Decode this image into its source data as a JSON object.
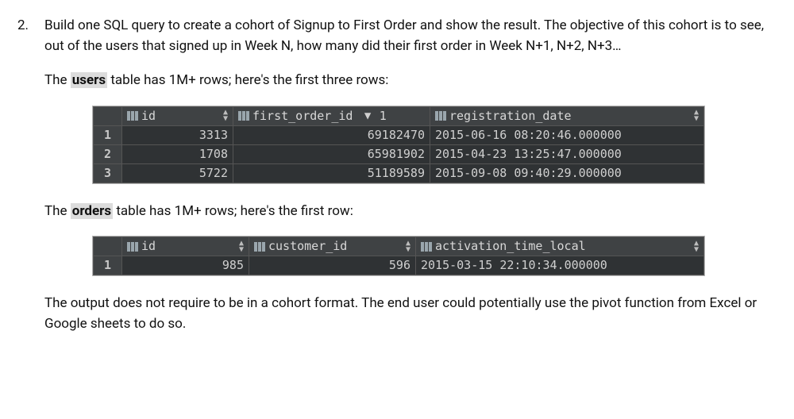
{
  "question": {
    "number": "2.",
    "prompt_main": "Build one SQL query to create a cohort of Signup to First Order and show the result. The objective of this cohort is to see, out of the users that signed up in Week N, how many did their first order in Week N+1, N+2, N+3…",
    "users_intro_pre": "The ",
    "users_intro_hl": "users",
    "users_intro_post": " table has 1M+ rows; here's the first three rows:",
    "orders_intro_pre": "The ",
    "orders_intro_hl": "orders",
    "orders_intro_post": " table has 1M+ rows; here's the first row:",
    "footer": "The output does not require to be in a cohort format. The end user could  potentially use the pivot function from Excel or Google sheets to do so."
  },
  "users_table": {
    "columns": [
      {
        "label": "id",
        "sort": "both"
      },
      {
        "label": "first_order_id",
        "sort": "down",
        "badge": "1"
      },
      {
        "label": "registration_date",
        "sort": "both"
      }
    ],
    "rows": [
      {
        "n": "1",
        "id": "3313",
        "first_order_id": "69182470",
        "registration_date": "2015-06-16 08:20:46.000000"
      },
      {
        "n": "2",
        "id": "1708",
        "first_order_id": "65981902",
        "registration_date": "2015-04-23 13:25:47.000000"
      },
      {
        "n": "3",
        "id": "5722",
        "first_order_id": "51189589",
        "registration_date": "2015-09-08 09:40:29.000000"
      }
    ]
  },
  "orders_table": {
    "columns": [
      {
        "label": "id",
        "sort": "both"
      },
      {
        "label": "customer_id",
        "sort": "both"
      },
      {
        "label": "activation_time_local",
        "sort": "both"
      }
    ],
    "rows": [
      {
        "n": "1",
        "id": "985",
        "customer_id": "596",
        "activation_time_local": "2015-03-15 22:10:34.000000"
      }
    ]
  }
}
